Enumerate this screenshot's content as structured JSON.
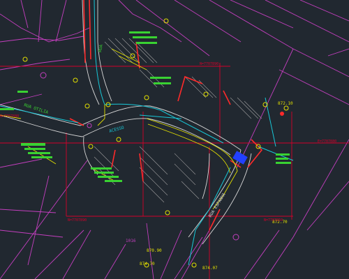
{
  "viewport": {
    "background": "#212830"
  },
  "colors": {
    "parcel": "#c43fbf",
    "grid": "#d4002a",
    "road_edge": "#d8d8d8",
    "curb": "#ff2a2a",
    "green": "#39d232",
    "cyan": "#18c8d8",
    "yellow": "#e3e000",
    "blue": "#2240ff",
    "hatch": "#9a9a9a"
  },
  "labels": {
    "street_rua_otilia": "RUA OTILIA",
    "street_rua_espanha": "RUA ESPANHA",
    "street_acesso": "ACESSO",
    "street_vertical": "RUA",
    "parcel_1016": "1016",
    "elev_870_90": "870.90",
    "elev_874_70": "874.70",
    "elev_872_10": "872.10",
    "elev_874_07": "874.07",
    "elev_872_70": "872.70",
    "grid_left_1": "N=7707890",
    "grid_left_2": "N=7707880",
    "grid_right_1": "E=7707880",
    "grid_right_2": "N=7707850",
    "grid_top_1": "N=7707890"
  }
}
